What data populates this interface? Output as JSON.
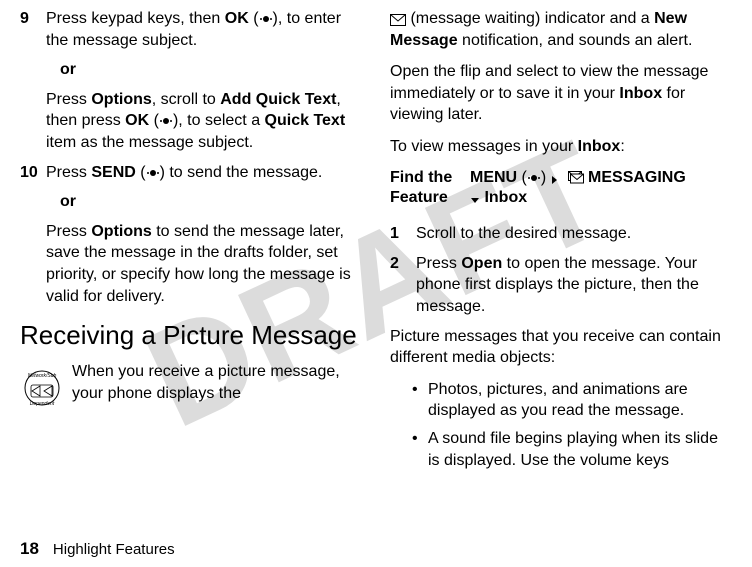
{
  "watermark": "DRAFT",
  "left": {
    "step9": {
      "num": "9",
      "seg1": "Press keypad keys, then ",
      "ok": "OK",
      "seg2": " (",
      "seg3": "), to enter the message subject.",
      "or": "or",
      "alt_seg1": "Press ",
      "options": "Options",
      "alt_seg2": ", scroll to ",
      "addqt": "Add Quick Text",
      "alt_seg3": ", then press ",
      "ok2": "OK",
      "alt_seg4": " (",
      "alt_seg5": "), to select a ",
      "quicktext": "Quick Text",
      "alt_seg6": " item as the message subject."
    },
    "step10": {
      "num": "10",
      "seg1": "Press ",
      "send": "SEND",
      "seg2": " (",
      "seg3": ") to send the message.",
      "or": "or",
      "alt_seg1": "Press ",
      "options": "Options",
      "alt_seg2": " to send the message later, save the message in the drafts folder, set priority, or specify how long the message is valid for delivery."
    },
    "heading": "Receiving a Picture Message",
    "recv_text": "When you receive a picture message, your phone displays the "
  },
  "right": {
    "cont_seg1": " (message waiting) indicator and a ",
    "newmsg": "New Message",
    "cont_seg2": " notification, and sounds an alert.",
    "para2_seg1": "Open the flip and select to view the message immediately or to save it in your ",
    "inbox": "Inbox",
    "para2_seg2": " for viewing later.",
    "para3_seg1": "To view messages in your ",
    "inbox2": "Inbox",
    "para3_seg2": ":",
    "feature_label_l1": "Find the",
    "feature_label_l2": "Feature",
    "menu": "MENU",
    "menu_lp": " (",
    "menu_rp": ") ",
    "messaging": "MESSAGING",
    "inbox3": "Inbox",
    "step1": {
      "num": "1",
      "text": "Scroll to the desired message."
    },
    "step2": {
      "num": "2",
      "seg1": "Press ",
      "open": "Open",
      "seg2": " to open the message. Your phone first displays the picture, then the message."
    },
    "para4": "Picture messages that you receive can contain different media objects:",
    "bul1": "Photos, pictures, and animations are displayed as you read the message.",
    "bul2": "A sound file begins playing when its slide is displayed. Use the volume keys"
  },
  "footer": {
    "page": "18",
    "title": "Highlight Features"
  }
}
